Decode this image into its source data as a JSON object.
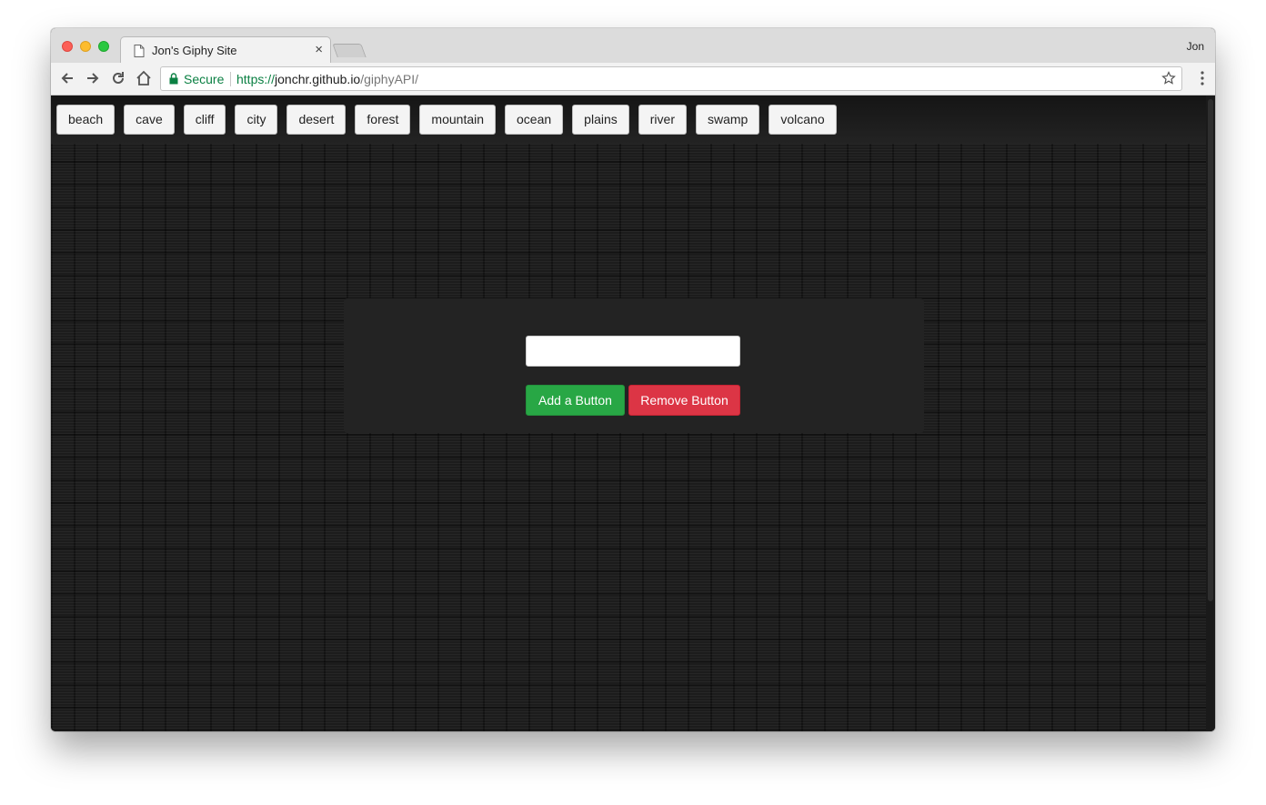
{
  "browser": {
    "tab_title": "Jon's Giphy Site",
    "tab_close": "×",
    "profile_name": "Jon",
    "secure_label": "Secure",
    "url_scheme": "https://",
    "url_host": "jonchr.github.io",
    "url_path": "/giphyAPI/"
  },
  "topics": [
    "beach",
    "cave",
    "cliff",
    "city",
    "desert",
    "forest",
    "mountain",
    "ocean",
    "plains",
    "river",
    "swamp",
    "volcano"
  ],
  "form": {
    "input_value": "",
    "add_label": "Add a Button",
    "remove_label": "Remove Button"
  },
  "colors": {
    "add_button": "#28a745",
    "remove_button": "#dc3545",
    "secure_green": "#0b8043"
  }
}
